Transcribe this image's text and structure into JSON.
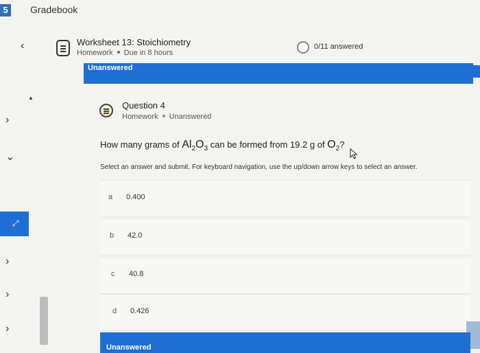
{
  "top_bar": {
    "tab_number": "5",
    "title": "Gradebook"
  },
  "header": {
    "worksheet_title": "Worksheet 13: Stoichiometry",
    "meta_type": "Homework",
    "meta_due": "Due in 8 hours",
    "progress_text": "0/11 answered"
  },
  "banner": {
    "status": "Unanswered"
  },
  "question": {
    "title": "Question 4",
    "meta_type": "Homework",
    "meta_status": "Unanswered",
    "text_prefix": "How many grams of ",
    "compound_el1": "Al",
    "compound_sub1": "2",
    "compound_el2": "O",
    "compound_sub2": "3",
    "text_middle": " can be formed from 19.2 g of ",
    "reactant_el": "O",
    "reactant_sub": "2",
    "text_suffix": "?",
    "instructions": "Select an answer and submit. For keyboard navigation, use the up/down arrow keys to select an answer."
  },
  "answers": [
    {
      "letter": "a",
      "value": "0.400"
    },
    {
      "letter": "b",
      "value": "42.0"
    },
    {
      "letter": "c",
      "value": "40.8"
    },
    {
      "letter": "d",
      "value": "0.426"
    }
  ],
  "footer": {
    "status": "Unanswered"
  },
  "icons": {
    "back": "chevron-left-icon",
    "worksheet": "document-icon",
    "progress": "progress-ring-icon",
    "question": "question-list-icon",
    "cursor": "mouse-pointer-icon"
  },
  "colors": {
    "accent": "#1f6ed4",
    "background": "#f3f3f1"
  }
}
